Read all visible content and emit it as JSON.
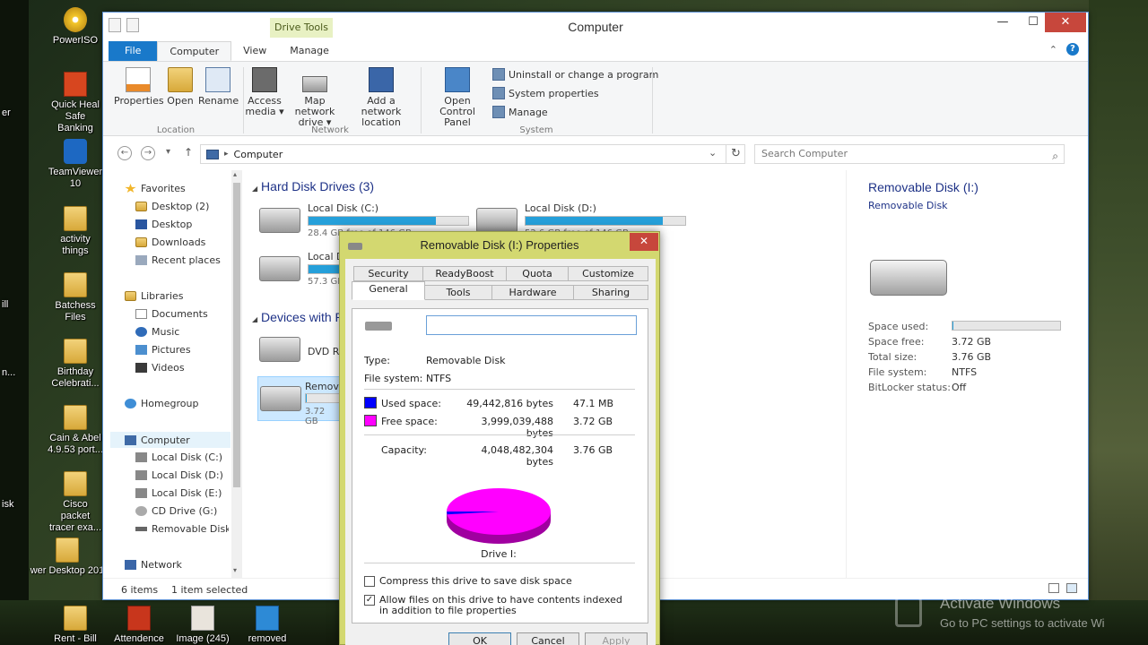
{
  "window": {
    "title": "Computer",
    "context_tab_group": "Drive Tools",
    "tabs": [
      "File",
      "Computer",
      "View",
      "Manage"
    ],
    "minimize_glyph": "—",
    "maximize_glyph": "☐",
    "close_glyph": "✕",
    "help_glyph": "?",
    "expand_glyph": "⌃"
  },
  "ribbon": {
    "location_group": {
      "label": "Location",
      "buttons": [
        "Properties",
        "Open",
        "Rename"
      ]
    },
    "network_group": {
      "label": "Network",
      "access_media": [
        "Access",
        "media ▾"
      ],
      "map_network_drive": [
        "Map network",
        "drive ▾"
      ],
      "add_network_location": [
        "Add a network",
        "location"
      ]
    },
    "system_group": {
      "label": "System",
      "open_control_panel": [
        "Open Control",
        "Panel"
      ],
      "small_items": [
        "Uninstall or change a program",
        "System properties",
        "Manage"
      ]
    }
  },
  "address": {
    "back_glyph": "←",
    "forward_glyph": "→",
    "recent_glyph": "▾",
    "up_glyph": "↑",
    "separator_glyph": "▸",
    "path": "Computer",
    "dropdown_glyph": "⌄",
    "refresh_glyph": "↻",
    "search_placeholder": "Search Computer",
    "search_glyph": "⌕"
  },
  "navigation": {
    "favorites": "Favorites",
    "favorite_items": [
      "Desktop (2)",
      "Desktop",
      "Downloads",
      "Recent places"
    ],
    "libraries": "Libraries",
    "library_items": [
      "Documents",
      "Music",
      "Pictures",
      "Videos"
    ],
    "homegroup": "Homegroup",
    "computer": "Computer",
    "computer_items": [
      "Local Disk (C:)",
      "Local Disk (D:)",
      "Local Disk (E:)",
      "CD Drive (G:)",
      "Removable Disk ("
    ],
    "network": "Network",
    "scroll_up_glyph": "▴",
    "scroll_down_glyph": "▾"
  },
  "content": {
    "hard_disk_header": "Hard Disk Drives (3)",
    "devices_header": "Devices with R",
    "collapse_glyph": "◢",
    "drives": [
      {
        "name": "Local Disk (C:)",
        "sub": "28.4 GB free of 146 GB",
        "fill_fraction": 0.8
      },
      {
        "name": "Local Disk (D:)",
        "sub": "52.6 GB free of 146 GB",
        "fill_fraction": 0.86
      },
      {
        "name": "Local D",
        "sub": "57.3 GB",
        "fill_fraction": 0.2
      },
      {
        "name": "DVD RW",
        "sub": "",
        "fill_fraction": 0
      },
      {
        "name": "Remova",
        "sub": "3.72 GB",
        "fill_fraction": 0.02
      }
    ]
  },
  "details": {
    "title": "Removable Disk (I:)",
    "subtitle": "Removable Disk",
    "rows": [
      {
        "label": "Space used:",
        "value": ""
      },
      {
        "label": "Space free:",
        "value": "3.72 GB"
      },
      {
        "label": "Total size:",
        "value": "3.76 GB"
      },
      {
        "label": "File system:",
        "value": "NTFS"
      },
      {
        "label": "BitLocker status:",
        "value": "Off"
      }
    ],
    "used_fraction": 0.012
  },
  "statusbar": {
    "items": "6 items",
    "selected": "1 item selected"
  },
  "dialog": {
    "title": "Removable Disk (I:) Properties",
    "close_glyph": "✕",
    "tabs_row1": [
      "Security",
      "ReadyBoost",
      "Quota",
      "Customize"
    ],
    "tabs_row2": [
      "General",
      "Tools",
      "Hardware",
      "Sharing"
    ],
    "name_value": "",
    "type_label": "Type:",
    "type_value": "Removable Disk",
    "fs_label": "File system:",
    "fs_value": "NTFS",
    "used_label": "Used space:",
    "used_bytes": "49,442,816 bytes",
    "used_size": "47.1 MB",
    "free_label": "Free space:",
    "free_bytes": "3,999,039,488 bytes",
    "free_size": "3.72 GB",
    "capacity_label": "Capacity:",
    "capacity_bytes": "4,048,482,304 bytes",
    "capacity_size": "3.76 GB",
    "drive_caption": "Drive I:",
    "compress_label": "Compress this drive to save disk space",
    "compress_checked": false,
    "index_label": "Allow files on this drive to have contents indexed in addition to file properties",
    "index_checked": true,
    "check_glyph": "✓",
    "ok_label": "OK",
    "cancel_label": "Cancel",
    "apply_label": "Apply",
    "used_color": "#0000ff",
    "free_color": "#ff00ff"
  },
  "desktop_icons": [
    "PowerISO",
    "Quick Heal Safe Banking",
    "TeamViewer 10",
    "activity things",
    "Batchess Files",
    "Birthday Celebrati...",
    "Cain & Abel 4.9.53 port...",
    "Cisco packet tracer exa...",
    "wer Desktop 201"
  ],
  "desktop_left_fragments": [
    "ill",
    "n...",
    "isk",
    "e",
    "er"
  ],
  "taskbar_icons": [
    "Rent - Bill",
    "Attendence",
    "Image (245)",
    "removed"
  ],
  "watermark": {
    "line1": "Activate Windows",
    "line2": "Go to PC settings to activate Wi"
  }
}
